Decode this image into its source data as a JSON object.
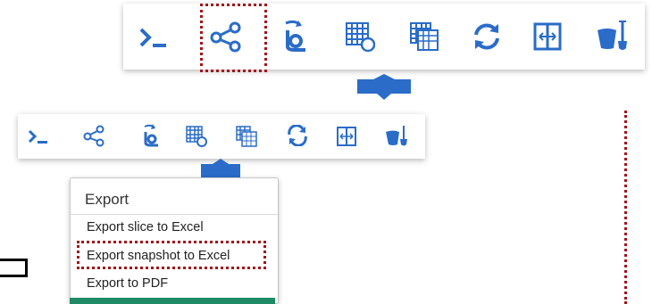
{
  "toolbar_icons": [
    "terminal-icon",
    "share-icon",
    "refresh-data-icon",
    "pivot-grid-icon",
    "pivot-grid-copy-icon",
    "sync-icon",
    "fit-width-icon",
    "bucket-shovel-icon"
  ],
  "menu": {
    "title": "Export",
    "items": [
      "Export slice to Excel",
      "Export snapshot to Excel",
      "Export to PDF"
    ]
  },
  "colors": {
    "accent": "#2a6cc8",
    "highlight": "#a3141a",
    "green": "#1f8a66"
  }
}
